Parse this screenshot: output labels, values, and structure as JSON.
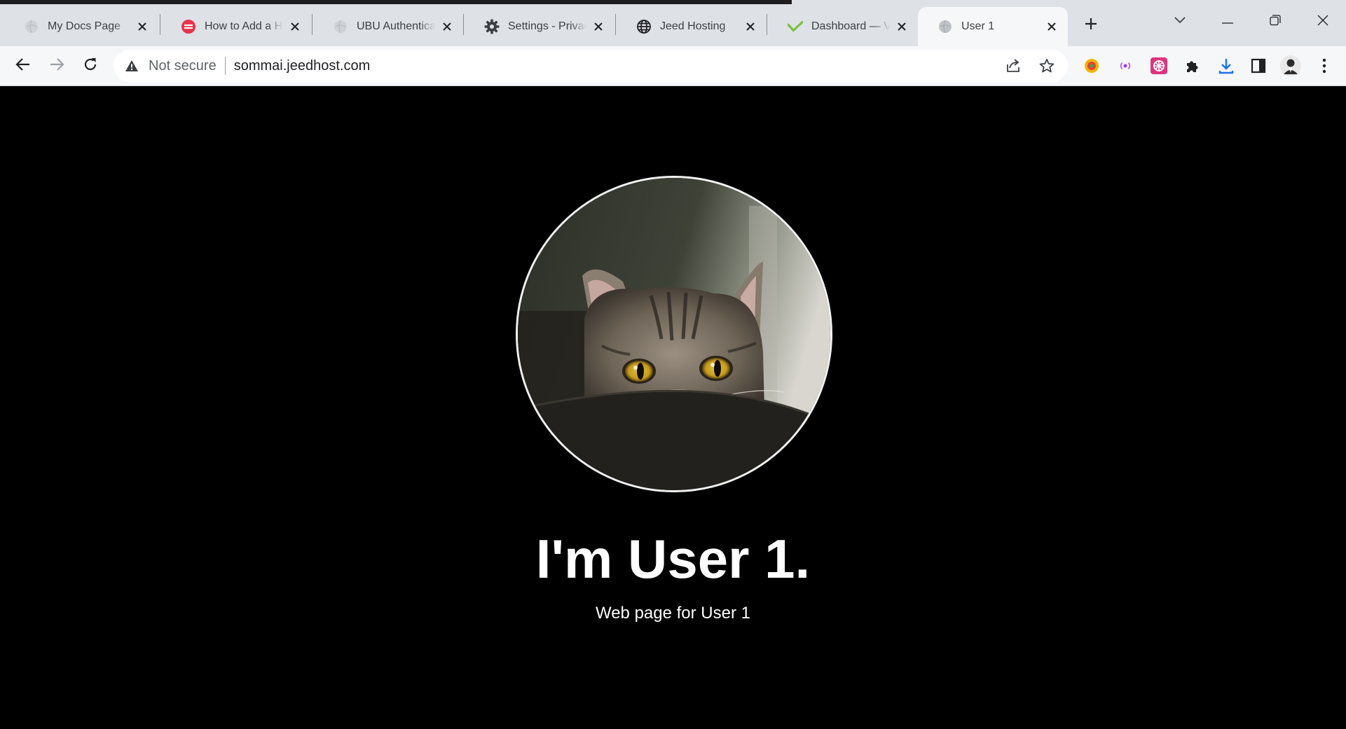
{
  "browser": {
    "tabs": [
      {
        "label": "My Docs Page",
        "favicon": "globe-gray-icon",
        "active": false
      },
      {
        "label": "How to Add a H",
        "favicon": "red-logo-icon",
        "active": false
      },
      {
        "label": "UBU Authentica",
        "favicon": "globe-gray-icon",
        "active": false
      },
      {
        "label": "Settings - Privac",
        "favicon": "gear-icon",
        "active": false
      },
      {
        "label": "Jeed Hosting",
        "favicon": "globe-icon",
        "active": false
      },
      {
        "label": "Dashboard — V",
        "favicon": "green-check-icon",
        "active": false
      },
      {
        "label": "User 1",
        "favicon": "globe-gray-icon",
        "active": true
      }
    ],
    "omnibox": {
      "security_label": "Not secure",
      "url": "sommai.jeedhost.com"
    },
    "colors": {
      "tabstrip": "#dee1e6",
      "toolbar": "#f6f7f9",
      "page_background": "#000000"
    }
  },
  "page": {
    "avatar_alt": "cat-photo",
    "headline": "I'm User 1.",
    "subtitle": "Web page for User 1"
  }
}
